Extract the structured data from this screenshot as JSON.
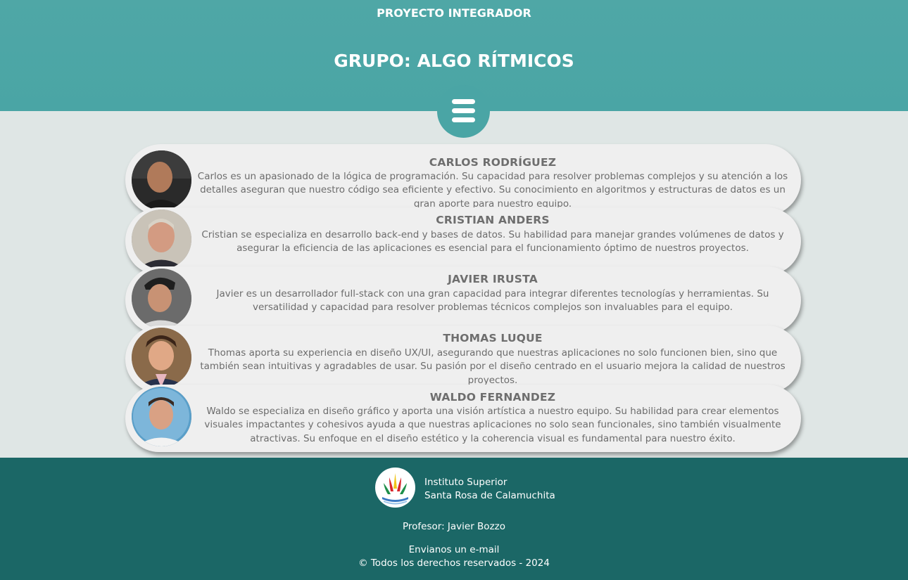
{
  "header": {
    "project": "PROYECTO INTEGRADOR",
    "group": "GRUPO: ALGO RÍTMICOS",
    "menu_icon": "hamburger-menu-icon",
    "color": "#4aa5a5"
  },
  "members": [
    {
      "name": "CARLOS RODRÍGUEZ",
      "bio": "Carlos es un apasionado de la lógica de programación. Su capacidad para resolver problemas complejos y su atención a los detalles aseguran que nuestro código sea eficiente y efectivo. Su conocimiento en algoritmos y estructuras de datos es un gran aporte para nuestro equipo."
    },
    {
      "name": "CRISTIAN ANDERS",
      "bio": "Cristian se especializa en desarrollo back-end y bases de datos. Su habilidad para manejar grandes volúmenes de datos y asegurar la eficiencia de las aplicaciones es esencial para el funcionamiento óptimo de nuestros proyectos."
    },
    {
      "name": "JAVIER IRUSTA",
      "bio": "Javier es un desarrollador full-stack con una gran capacidad para integrar diferentes tecnologías y herramientas. Su versatilidad y capacidad para resolver problemas técnicos complejos son invaluables para el equipo."
    },
    {
      "name": "THOMAS LUQUE",
      "bio": "Thomas aporta su experiencia en diseño UX/UI, asegurando que nuestras aplicaciones no solo funcionen bien, sino que también sean intuitivas y agradables de usar. Su pasión por el diseño centrado en el usuario mejora la calidad de nuestros proyectos."
    },
    {
      "name": "WALDO FERNANDEZ",
      "bio": "Waldo se especializa en diseño gráfico y aporta una visión artística a nuestro equipo. Su habilidad para crear elementos visuales impactantes y cohesivos ayuda a que nuestras aplicaciones no solo sean funcionales, sino también visualmente atractivas. Su enfoque en el diseño estético y la coherencia visual es fundamental para nuestro éxito."
    }
  ],
  "footer": {
    "institute_line1": "Instituto Superior",
    "institute_line2": "Santa Rosa de Calamuchita",
    "professor": "Profesor: Javier Bozzo",
    "email_link": "Envianos un e-mail",
    "copyright": "© Todos los derechos reservados - 2024",
    "color": "#1b6766"
  }
}
